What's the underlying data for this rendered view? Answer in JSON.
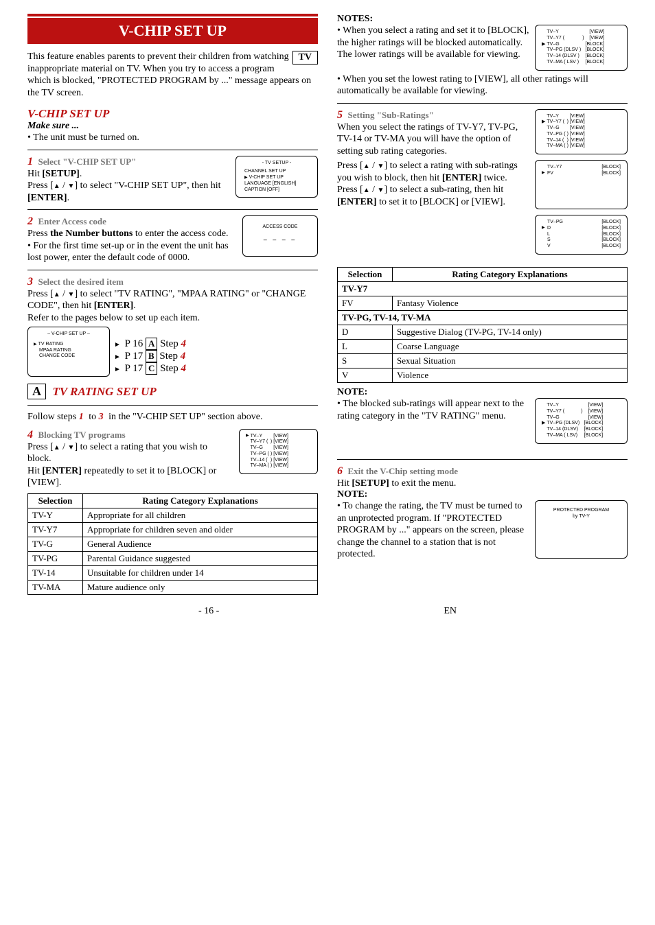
{
  "banner": "V-CHIP SET UP",
  "tv_label": "TV",
  "intro": "This feature enables parents to prevent their children from watching inappropriate material on TV. When you try to access a program which is blocked, \"PROTECTED PROGRAM by ...\" message appears on the TV screen.",
  "section_title": "V-CHIP SET UP",
  "make_sure": "Make sure ...",
  "make_sure_item": "The unit must be turned on.",
  "step1_title": "Select \"V-CHIP SET UP\"",
  "step1_body1": "Hit ",
  "step1_setup": "[SETUP]",
  "step1_body2": "Press [",
  "step1_body3": "] to select \"V-CHIP SET UP\", then hit ",
  "step1_enter": "[ENTER]",
  "osd1_title": "- TV SETUP -",
  "osd1_l1": "CHANNEL SET UP",
  "osd1_l2": "V-CHIP SET UP",
  "osd1_l3": "LANGUAGE  [ENGLISH]",
  "osd1_l4": "CAPTION  [OFF]",
  "step2_title": "Enter Access code",
  "step2_body1": "Press ",
  "step2_nb": "the Number buttons",
  "step2_body2": " to enter the access code.",
  "step2_bullet": "For the first time set-up or in the event the unit has lost power, enter the default code of 0000.",
  "osd2_title": "ACCESS CODE",
  "osd2_dashes": "– – – –",
  "step3_title": "Select the desired item",
  "step3_body1": "Press [",
  "step3_body2": "] to select \"TV RATING\", \"MPAA RATING\" or \"CHANGE CODE\", then hit ",
  "step3_body3": "Refer to the pages below to set up each item.",
  "osd3_title": "– V-CHIP SET UP –",
  "osd3_l1": "TV RATING",
  "osd3_l2": "MPAA RATING",
  "osd3_l3": "CHANGE CODE",
  "ptr1": "P 16",
  "ptr1_letter": "A",
  "ptr1_step": "Step",
  "ptr1_n": "4",
  "ptr2": "P 17",
  "ptr2_letter": "B",
  "ptr3": "P 17",
  "ptr3_letter": "C",
  "sectA_letter": "A",
  "sectA_title": "TV RATING SET UP",
  "sectA_body": "Follow steps ",
  "sectA_1": "1",
  "sectA_to": " to ",
  "sectA_3": "3",
  "sectA_body2": " in the \"V-CHIP SET UP\" section above.",
  "step4_title": "Blocking TV programs",
  "step4_body1": "Press [",
  "step4_body2": "] to select a rating that you wish to block.",
  "step4_body3": "Hit ",
  "step4_body4": " repeatedly to set it to [BLOCK] or [VIEW].",
  "osd4": {
    "rows": [
      [
        "TV–Y",
        "",
        "[VIEW]"
      ],
      [
        "TV–Y7 (",
        "        )",
        "[VIEW]"
      ],
      [
        "TV–G",
        "",
        "[VIEW]"
      ],
      [
        "TV–PG (",
        "        )",
        "[VIEW]"
      ],
      [
        "TV–14 (",
        "        )",
        "[VIEW]"
      ],
      [
        "TV–MA (",
        "        )",
        "[VIEW]"
      ]
    ]
  },
  "rtable1_h1": "Selection",
  "rtable1_h2": "Rating Category Explanations",
  "rtable1": [
    [
      "TV-Y",
      "Appropriate for all children"
    ],
    [
      "TV-Y7",
      "Appropriate for children seven and older"
    ],
    [
      "TV-G",
      "General Audience"
    ],
    [
      "TV-PG",
      "Parental Guidance suggested"
    ],
    [
      "TV-14",
      "Unsuitable for children under 14"
    ],
    [
      "TV-MA",
      "Mature audience only"
    ]
  ],
  "notes_hd": "NOTES:",
  "note1": "When you select a rating and set it to [BLOCK], the higher ratings will be blocked automatically. The lower ratings will be available for viewing.",
  "note2": "When you set the lowest rating to [VIEW], all other ratings will automatically be available for viewing.",
  "osdN1": {
    "rows": [
      [
        "",
        "TV–Y",
        "",
        "[VIEW]"
      ],
      [
        "",
        "TV–Y7 (",
        "        )",
        "[VIEW]"
      ],
      [
        "▶",
        "TV–G",
        "",
        "[BLOCK]"
      ],
      [
        "",
        "TV–PG (DLSV )",
        "",
        "[BLOCK]"
      ],
      [
        "",
        "TV–14  (DLSV )",
        "",
        "[BLOCK]"
      ],
      [
        "",
        "TV–MA (  LSV )",
        "",
        "[BLOCK]"
      ]
    ]
  },
  "step5_title": "Setting \"Sub-Ratings\"",
  "step5_body1": "When you select the ratings of TV-Y7, TV-PG, TV-14 or TV-MA you will have the option of setting sub rating categories.",
  "step5_body2a": "Press [",
  "step5_body2b": "] to select a rating with sub-ratings you wish to block, then hit ",
  "step5_body2c": " twice.",
  "step5_body3a": "Press [",
  "step5_body3b": "] to select a sub-rating, then hit ",
  "step5_body3c": " to set it to [BLOCK] or [VIEW].",
  "osd5a": {
    "rows": [
      [
        "",
        "TV–Y",
        "",
        "[VIEW]"
      ],
      [
        "▶",
        "TV–Y7 (",
        "        )",
        "[VIEW]"
      ],
      [
        "",
        "TV–G",
        "",
        "[VIEW]"
      ],
      [
        "",
        "TV–PG (",
        "        )",
        "[VIEW]"
      ],
      [
        "",
        "TV–14 (",
        "        )",
        "[VIEW]"
      ],
      [
        "",
        "TV–MA (",
        "        )",
        "[VIEW]"
      ]
    ]
  },
  "osd5b": {
    "rows": [
      [
        "",
        "TV–Y7",
        "[BLOCK]"
      ],
      [
        "▶",
        "FV",
        "[BLOCK]"
      ]
    ]
  },
  "osd5c": {
    "rows": [
      [
        "",
        "TV–PG",
        "[BLOCK]"
      ],
      [
        "▶",
        "D",
        "[BLOCK]"
      ],
      [
        "",
        "L",
        "[BLOCK]"
      ],
      [
        "",
        "S",
        "[BLOCK]"
      ],
      [
        "",
        "V",
        "[BLOCK]"
      ]
    ]
  },
  "rtable2_h1": "Selection",
  "rtable2_h2": "Rating Category Explanations",
  "rtable2_r1": "TV-Y7",
  "rtable2_r2a": "FV",
  "rtable2_r2b": "Fantasy Violence",
  "rtable2_r3": "TV-PG, TV-14, TV-MA",
  "rtable2": [
    [
      "D",
      "Suggestive Dialog    (TV-PG, TV-14 only)"
    ],
    [
      "L",
      "Coarse Language"
    ],
    [
      "S",
      "Sexual Situation"
    ],
    [
      "V",
      "Violence"
    ]
  ],
  "note_hd2": "NOTE:",
  "note3": "The blocked sub-ratings will appear next to the rating category in the \"TV RATING\" menu.",
  "osdN2": {
    "rows": [
      [
        "",
        "TV–Y",
        "",
        "[VIEW]"
      ],
      [
        "",
        "TV–Y7 (",
        "        )",
        "[VIEW]"
      ],
      [
        "",
        "TV–G",
        "",
        "[VIEW]"
      ],
      [
        "▶",
        "TV–PG (DLSV)",
        "",
        "[BLOCK]"
      ],
      [
        "",
        "TV–14  (DLSV)",
        "",
        "[BLOCK]"
      ],
      [
        "",
        "TV–MA (  LSV)",
        "",
        "[BLOCK]"
      ]
    ]
  },
  "step6_title": "Exit the V-Chip setting mode",
  "step6_body1": "Hit ",
  "step6_body2": " to exit the menu.",
  "note4": "To change the rating, the TV must be turned to an unprotected program. If \"PROTECTED PROGRAM by ...\" appears on the screen, please change the channel to a station that is not protected.",
  "osdP_l1": "PROTECTED PROGRAM",
  "osdP_l2": "by TV-Y",
  "page": "- 16 -",
  "page_suffix": "EN"
}
